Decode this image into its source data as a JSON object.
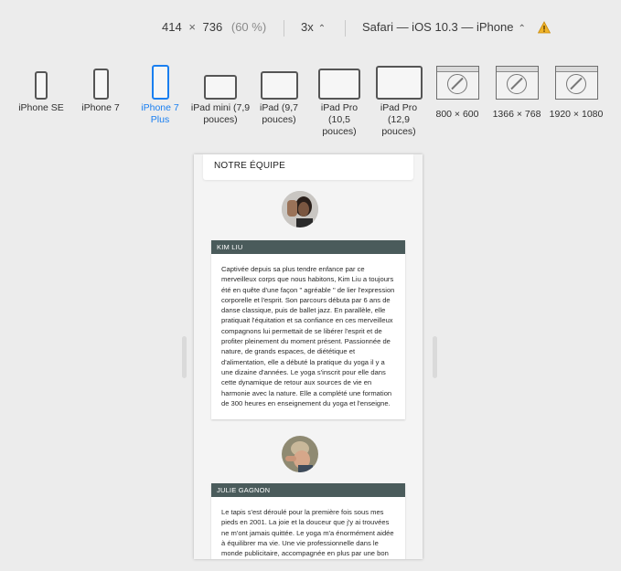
{
  "toolbar": {
    "width": "414",
    "times": "×",
    "height": "736",
    "zoom": "(60 %)",
    "scale": "3x",
    "device": "Safari — iOS 10.3 — iPhone"
  },
  "devices": [
    {
      "label": "iPhone SE",
      "icon": "phone-icon"
    },
    {
      "label": "iPhone 7",
      "icon": "phone-icon"
    },
    {
      "label": "iPhone 7 Plus",
      "icon": "phone-icon",
      "active": true
    },
    {
      "label": "iPad mini (7,9 pouces)",
      "icon": "tablet-icon"
    },
    {
      "label": "iPad (9,7 pouces)",
      "icon": "tablet-icon"
    },
    {
      "label": "iPad Pro (10,5 pouces)",
      "icon": "tablet-icon"
    },
    {
      "label": "iPad Pro (12,9 pouces)",
      "icon": "tablet-icon"
    },
    {
      "label": "800 × 600",
      "icon": "browser-icon"
    },
    {
      "label": "1366 × 768",
      "icon": "browser-icon"
    },
    {
      "label": "1920 × 1080",
      "icon": "browser-icon"
    }
  ],
  "page": {
    "section_title": "NOTRE ÉQUIPE",
    "members": [
      {
        "name": "KIM LIU",
        "bio": "Captivée depuis sa plus tendre enfance par ce merveilleux corps que nous habitons, Kim Liu a toujours été en quête d'une façon \" agréable \" de lier l'expression corporelle et l'esprit. Son parcours débuta par 6 ans de danse classique, puis de ballet jazz. En parallèle, elle pratiquait l'équitation et sa confiance en ces merveilleux compagnons lui permettait de se libérer l'esprit et de profiter pleinement du moment présent. Passionnée de nature, de grands espaces, de diététique et d'alimentation, elle a débuté la pratique du yoga il y a une dizaine d'années. Le yoga s'inscrit pour elle dans cette dynamique de retour aux sources de vie en harmonie avec la nature. Elle a complété une formation de 300 heures en enseignement du yoga et l'enseigne."
      },
      {
        "name": "JULIE GAGNON",
        "bio": "Le tapis s'est déroulé pour la première fois sous mes pieds en 2001. La joie et la douceur que j'y ai trouvées ne m'ont jamais quittée. Le yoga m'a énormément aidée à équilibrer ma vie. Une vie professionnelle dans le monde publicitaire, accompagnée en plus par une bon côté à un"
      }
    ]
  },
  "colors": {
    "accent": "#1a7ff0",
    "card_header": "#4a5b5b",
    "warning": "#f0b429"
  }
}
